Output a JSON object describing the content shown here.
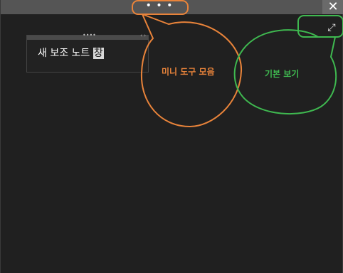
{
  "titlebar": {
    "more_label": "• • •",
    "close_label": "✕"
  },
  "toolbar": {
    "expand_icon": "expand-icon",
    "expand_glyph": "⤢"
  },
  "mini_window": {
    "title_prefix": "새 보조 노트 ",
    "title_selected": "창",
    "dots": "••••",
    "controls": "‹ ›"
  },
  "annotations": {
    "mini_toolbar_label": "미니 도구 모음",
    "default_view_label": "기본 보기",
    "orange": "#e8833a",
    "green": "#3fb950"
  },
  "colors": {
    "titlebar_bg": "#555555",
    "window_bg": "#202020"
  }
}
